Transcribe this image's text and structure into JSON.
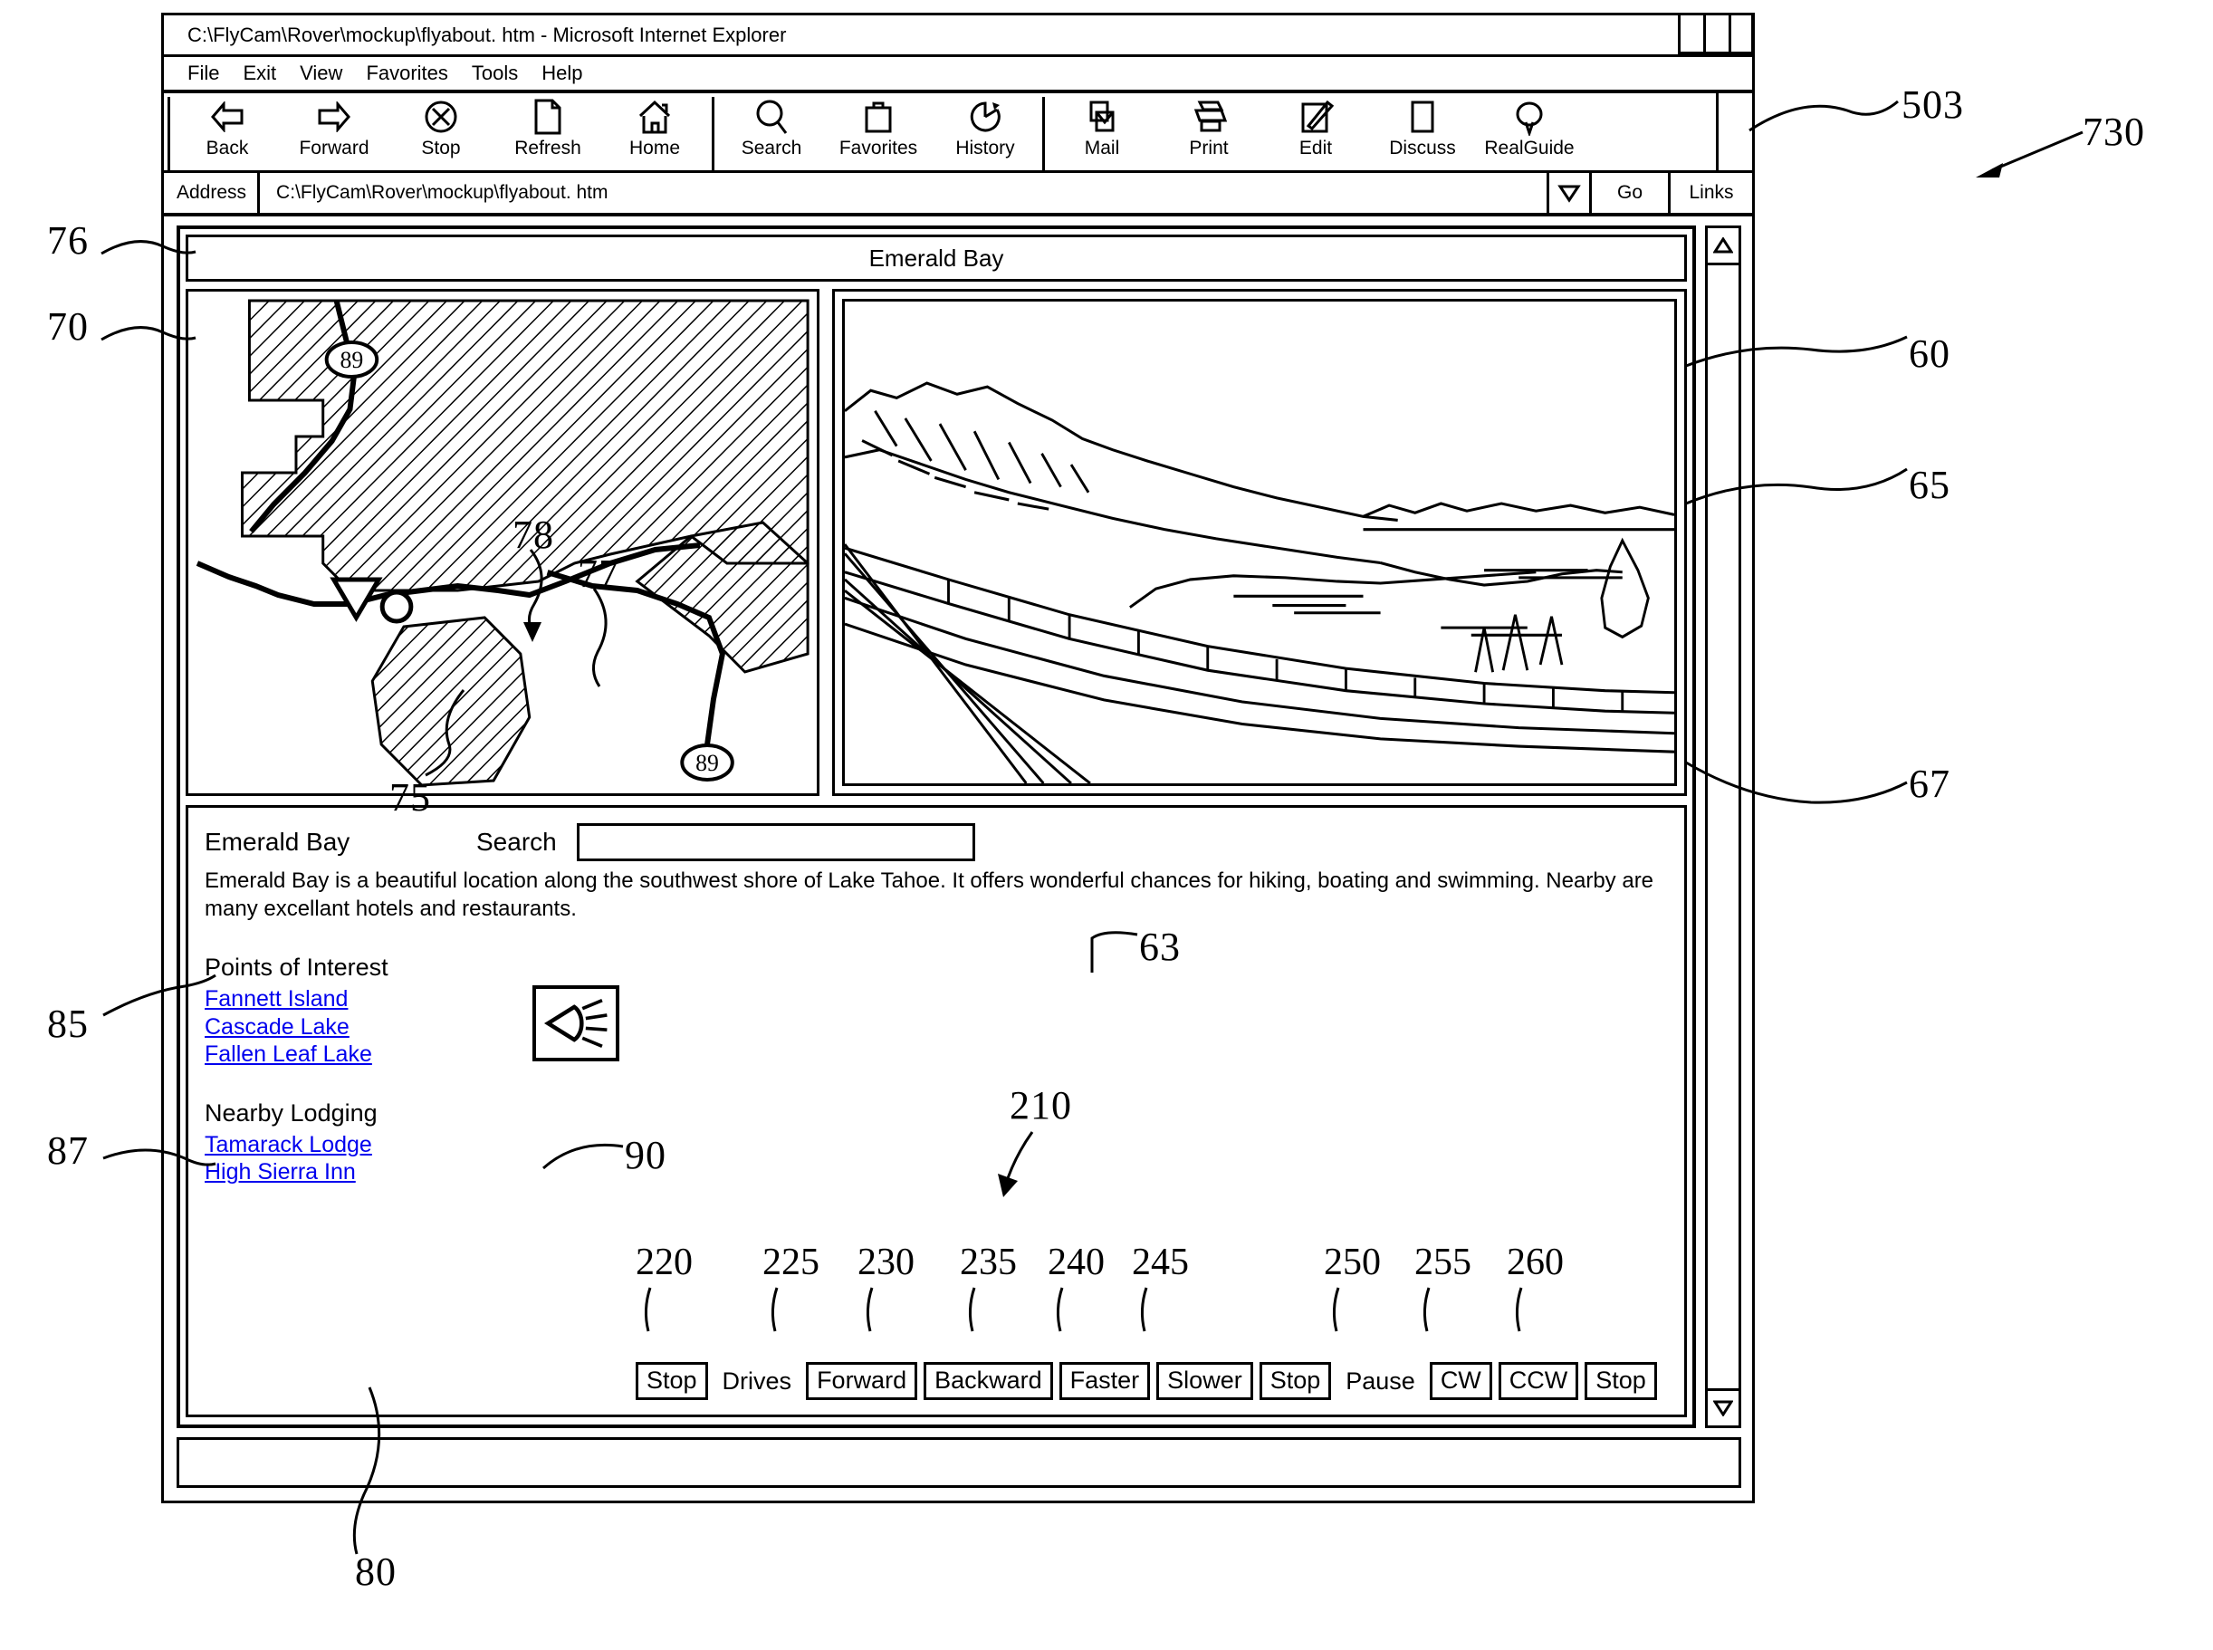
{
  "window": {
    "title": "C:\\FlyCam\\Rover\\mockup\\flyabout. htm - Microsoft Internet Explorer"
  },
  "menu": {
    "items": [
      {
        "label": "File"
      },
      {
        "label": "Exit"
      },
      {
        "label": "View"
      },
      {
        "label": "Favorites"
      },
      {
        "label": "Tools"
      },
      {
        "label": "Help"
      }
    ]
  },
  "toolbar": {
    "group1": [
      {
        "label": "Back",
        "icon": "back-arrow-icon"
      },
      {
        "label": "Forward",
        "icon": "forward-arrow-icon"
      },
      {
        "label": "Stop",
        "icon": "stop-x-circle-icon"
      },
      {
        "label": "Refresh",
        "icon": "page-refresh-icon"
      },
      {
        "label": "Home",
        "icon": "home-house-icon"
      }
    ],
    "group2": [
      {
        "label": "Search",
        "icon": "search-magnifier-icon"
      },
      {
        "label": "Favorites",
        "icon": "favorites-folder-icon"
      },
      {
        "label": "History",
        "icon": "history-clock-icon"
      }
    ],
    "group3": [
      {
        "label": "Mail",
        "icon": "mail-envelope-icon"
      },
      {
        "label": "Print",
        "icon": "printer-icon"
      },
      {
        "label": "Edit",
        "icon": "edit-pencil-icon"
      },
      {
        "label": "Discuss",
        "icon": "discuss-page-icon"
      },
      {
        "label": "RealGuide",
        "icon": "realguide-balloon-icon"
      }
    ]
  },
  "address": {
    "label": "Address",
    "value": "C:\\FlyCam\\Rover\\mockup\\flyabout. htm",
    "dropdown_icon": "chevron-down-icon",
    "go_label": "Go",
    "links_label": "Links"
  },
  "page": {
    "title": "Emerald Bay",
    "place_name": "Emerald Bay",
    "search_label": "Search",
    "search_value": "",
    "search_placeholder": "",
    "description": "Emerald Bay is a beautiful location along the southwest shore of Lake Tahoe.  It offers wonderful chances for hiking, boating and swimming. Nearby are many excellant hotels and restaurants.",
    "points_of_interest": {
      "heading": "Points of Interest",
      "items": [
        "Fannett Island",
        "Cascade Lake",
        "Fallen Leaf Lake"
      ]
    },
    "nearby_lodging": {
      "heading": "Nearby Lodging",
      "items": [
        "Tamarack Lodge",
        "High Sierra Inn"
      ]
    },
    "light_icon": "headlight-beam-icon"
  },
  "map": {
    "route_marker_top": "89",
    "route_marker_bottom": "89"
  },
  "controls": [
    {
      "label": "Stop",
      "ref": "220",
      "boxed": true
    },
    {
      "label": "Drives",
      "ref": "",
      "boxed": false
    },
    {
      "label": "Forward",
      "ref": "225",
      "boxed": true
    },
    {
      "label": "Backward",
      "ref": "230",
      "boxed": true
    },
    {
      "label": "Faster",
      "ref": "235",
      "boxed": true
    },
    {
      "label": "Slower",
      "ref": "240",
      "boxed": true
    },
    {
      "label": "Stop",
      "ref": "245",
      "boxed": true
    },
    {
      "label": "Pause",
      "ref": "",
      "boxed": false
    },
    {
      "label": "CW",
      "ref": "250",
      "boxed": true
    },
    {
      "label": "CCW",
      "ref": "255",
      "boxed": true
    },
    {
      "label": "Stop",
      "ref": "260",
      "boxed": true
    }
  ],
  "reference_numbers": {
    "r76": "76",
    "r70": "70",
    "r75": "75",
    "r78": "78",
    "r77": "77",
    "r85": "85",
    "r87": "87",
    "r80": "80",
    "r90": "90",
    "r210": "210",
    "r503": "503",
    "r730": "730",
    "r60": "60",
    "r65": "65",
    "r67": "67",
    "r63": "63"
  }
}
